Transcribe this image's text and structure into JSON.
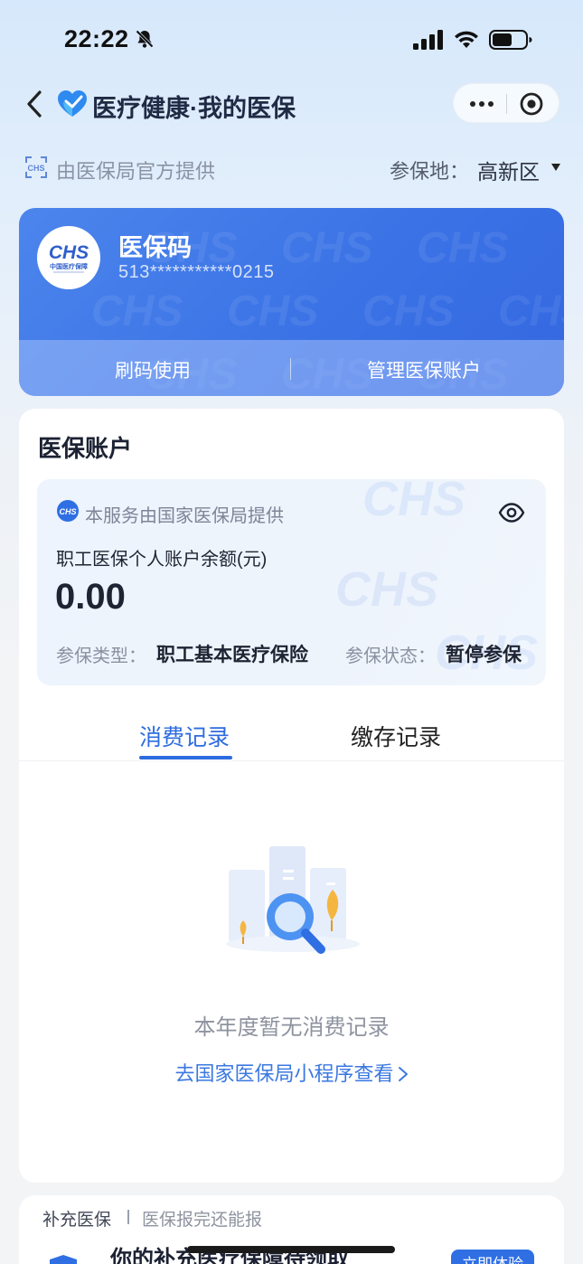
{
  "status_bar": {
    "time": "22:22",
    "icons": [
      "bell-slash-icon",
      "signal-icon",
      "wifi-icon",
      "battery-icon"
    ]
  },
  "nav": {
    "title": "医疗健康·我的医保",
    "back_icon": "chevron-left-icon",
    "logo_icon": "heart-logo-icon",
    "capsule_icons": [
      "more-dots-icon",
      "target-icon"
    ]
  },
  "provider": {
    "text": "由医保局官方提供",
    "region_label": "参保地：",
    "region_value": "高新区"
  },
  "code_card": {
    "title": "医保码",
    "number": "513***********0215",
    "logo_text": "CHS",
    "logo_subtext": "中国医疗保障",
    "actions": {
      "scan": "刷码使用",
      "manage": "管理医保账户"
    },
    "colors": {
      "card_top": "#4c85ec",
      "card_bottom": "#3467e0"
    }
  },
  "account": {
    "title": "医保账户",
    "gov_text": "本服务由国家医保局提供",
    "balance_label": "职工医保个人账户余额(元)",
    "balance_value": "0.00",
    "type_label": "参保类型：",
    "type_value": "职工基本医疗保险",
    "state_label": "参保状态：",
    "state_value": "暂停参保",
    "tabs": [
      {
        "label": "消费记录",
        "active": true
      },
      {
        "label": "缴存记录",
        "active": false
      }
    ],
    "empty_text": "本年度暂无消费记录",
    "goto_link": "去国家医保局小程序查看"
  },
  "supplement": {
    "tag": "补充医保",
    "subtitle": "医保报完还能报",
    "title": "你的补充医疗保障待领取",
    "button": "立即体验"
  },
  "colors": {
    "accent": "#2d6cdf",
    "link": "#3a78e0"
  }
}
